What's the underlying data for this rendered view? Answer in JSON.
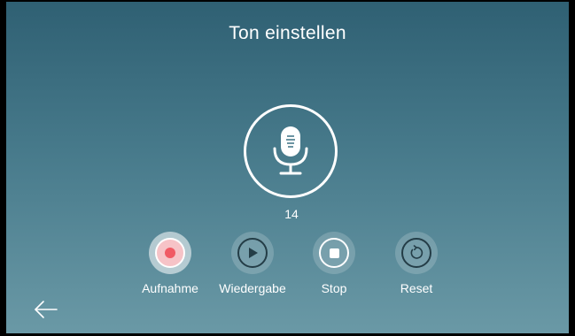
{
  "header": {
    "title": "Ton einstellen"
  },
  "recorder": {
    "icon": "microphone-icon",
    "counter": "14"
  },
  "controls": [
    {
      "label": "Aufnahme",
      "icon": "record-icon",
      "active": true,
      "accent": "#f05a64"
    },
    {
      "label": "Wiedergabe",
      "icon": "play-icon",
      "active": false
    },
    {
      "label": "Stop",
      "icon": "stop-icon",
      "active": false
    },
    {
      "label": "Reset",
      "icon": "reset-icon",
      "active": false
    }
  ],
  "navigation": {
    "back_icon": "arrow-left-icon"
  },
  "colors": {
    "background_top": "#2f6073",
    "background_bottom": "#6a99a6",
    "record_accent": "#f05a64",
    "text": "#ffffff"
  }
}
